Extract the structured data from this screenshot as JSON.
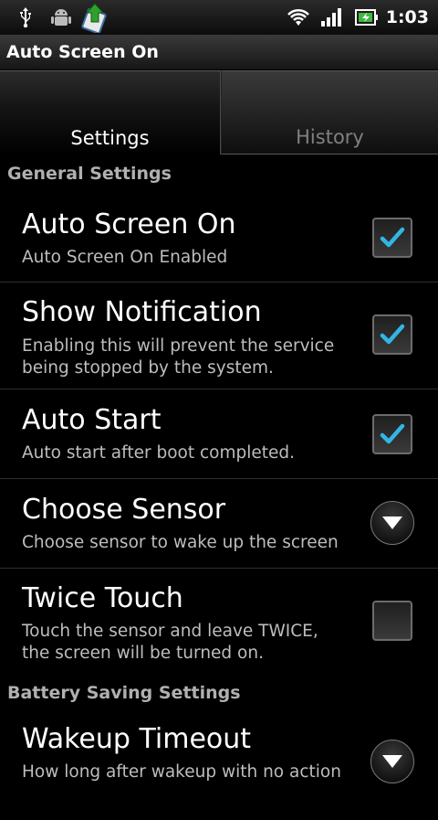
{
  "status_bar": {
    "time": "1:03",
    "left_icons": [
      "usb-icon",
      "android-debug-icon",
      "upload-app-icon"
    ],
    "right_icons": [
      "wifi-icon",
      "signal-icon",
      "battery-charging-icon"
    ]
  },
  "app": {
    "title": "Auto Screen On"
  },
  "tabs": [
    {
      "label": "Settings",
      "selected": true
    },
    {
      "label": "History",
      "selected": false
    }
  ],
  "sections": [
    {
      "header": "General Settings",
      "items": [
        {
          "title": "Auto Screen On",
          "summary": "Auto Screen On Enabled",
          "control": "checkbox",
          "checked": true
        },
        {
          "title": "Show Notification",
          "summary": "Enabling this will prevent the service being stopped by the system.",
          "control": "checkbox",
          "checked": true
        },
        {
          "title": "Auto Start",
          "summary": "Auto start after boot completed.",
          "control": "checkbox",
          "checked": true
        },
        {
          "title": "Choose Sensor",
          "summary": "Choose sensor to wake up the screen",
          "control": "dropdown"
        },
        {
          "title": "Twice Touch",
          "summary": "Touch the sensor and leave TWICE, the screen will be turned on.",
          "control": "checkbox",
          "checked": false
        }
      ]
    },
    {
      "header": "Battery Saving Settings",
      "items": [
        {
          "title": "Wakeup Timeout",
          "summary": "How long after wakeup with no action",
          "control": "dropdown"
        }
      ]
    }
  ],
  "colors": {
    "check": "#33b5e5",
    "section_header": "#b0b0b0",
    "summary": "#bdbdbd"
  }
}
